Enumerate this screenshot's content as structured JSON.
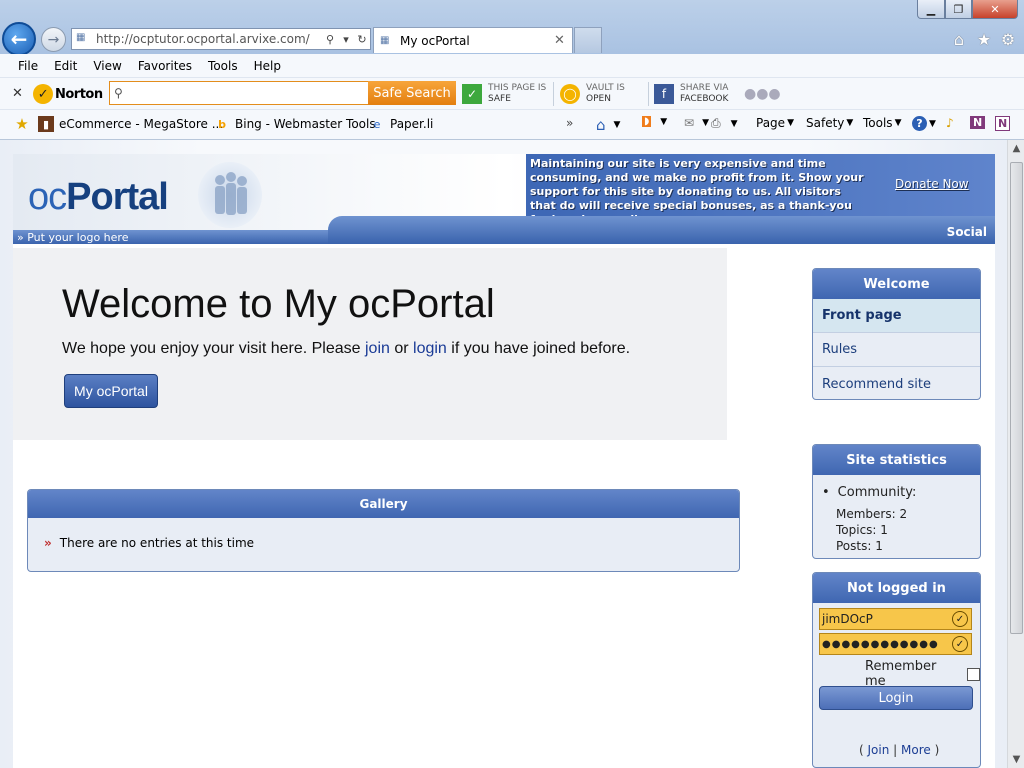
{
  "browser": {
    "address_url": "http://ocptutor.ocportal.arvixe.com/",
    "tab_title": "My ocPortal",
    "menu": [
      "File",
      "Edit",
      "View",
      "Favorites",
      "Tools",
      "Help"
    ],
    "norton": {
      "logo": "Norton",
      "search_button": "Safe Search",
      "page_status_label": "THIS PAGE IS",
      "page_status_value": "SAFE",
      "vault_label": "VAULT IS",
      "vault_value": "OPEN",
      "share_label": "SHARE VIA",
      "share_value": "FACEBOOK"
    },
    "favorites": [
      "eCommerce - MegaStore ...",
      "Bing - Webmaster Tools",
      "Paper.li"
    ],
    "commands": [
      "Page",
      "Safety",
      "Tools"
    ]
  },
  "site": {
    "logo_oc": "oc",
    "logo_portal": "Portal",
    "donate_text": "Maintaining our site is very expensive and time consuming, and we make no profit from it. Show your support for this site by donating to us. All visitors that do will receive special bonuses, as a thank-you for keeping us alive.",
    "donate_link": "Donate Now",
    "put_logo": "Put your logo here",
    "social": "Social"
  },
  "welcome": {
    "title": "Welcome to My ocPortal",
    "msg_before": "We hope you enjoy your visit here. Please ",
    "join": "join",
    "msg_or": " or ",
    "login": "login",
    "msg_after": " if you have joined before.",
    "button": "My ocPortal"
  },
  "gallery": {
    "title": "Gallery",
    "empty": "There are no entries at this time"
  },
  "sidebar": {
    "welcome_title": "Welcome",
    "menu": [
      "Front page",
      "Rules",
      "Recommend site"
    ],
    "stats_title": "Site statistics",
    "community": "Community:",
    "members": "Members:  2",
    "topics": "Topics:  1",
    "posts": "Posts:  1",
    "login_title": "Not logged in",
    "username": "jimDOcP",
    "password": "●●●●●●●●●●●●",
    "remember": "Remember me",
    "login_button": "Login",
    "join_link": "Join",
    "more_link": "More"
  }
}
